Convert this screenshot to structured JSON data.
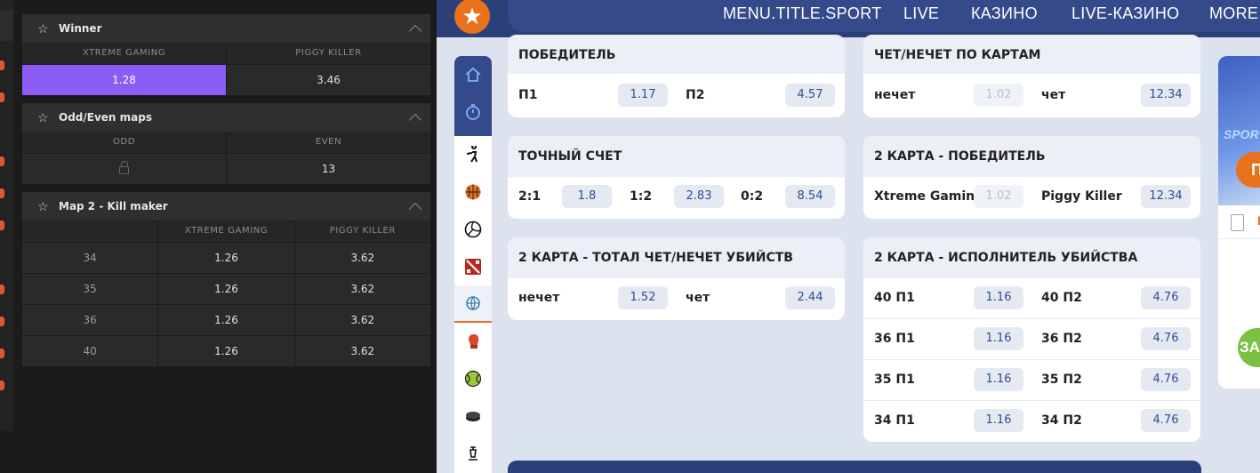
{
  "left_panel": {
    "winner": {
      "title": "Winner",
      "columns": [
        "XTREME GAMING",
        "PIGGY KILLER"
      ],
      "odds": [
        "1.28",
        "3.46"
      ]
    },
    "odd_even": {
      "title": "Odd/Even maps",
      "columns": [
        "ODD",
        "EVEN"
      ],
      "odds": [
        "",
        "13"
      ]
    },
    "kill_maker": {
      "title": "Map 2 - Kill maker",
      "columns": [
        "",
        "XTREME GAMING",
        "PIGGY KILLER"
      ],
      "rows": [
        {
          "label": "34",
          "a": "1.26",
          "b": "3.62"
        },
        {
          "label": "35",
          "a": "1.26",
          "b": "3.62"
        },
        {
          "label": "36",
          "a": "1.26",
          "b": "3.62"
        },
        {
          "label": "40",
          "a": "1.26",
          "b": "3.62"
        }
      ]
    }
  },
  "nav": {
    "items": [
      "MENU.TITLE.SPORT",
      "LIVE",
      "КАЗИНО",
      "LIVE-КАЗИНО",
      "MORE ..."
    ]
  },
  "sidebar_icons": [
    "home-icon",
    "stopwatch-icon",
    "cs-soldier-icon",
    "basketball-icon",
    "volleyball-icon",
    "dota-icon",
    "esports-globe-icon",
    "boxing-icon",
    "tennis-icon",
    "hockey-puck-icon",
    "chess-icon"
  ],
  "markets": {
    "winner": {
      "title": "ПОБЕДИТЕЛЬ",
      "items": [
        {
          "label": "П1",
          "odd": "1.17"
        },
        {
          "label": "П2",
          "odd": "4.57"
        }
      ]
    },
    "parity": {
      "title": "ЧЕТ/НЕЧЕТ ПО КАРТАМ",
      "items": [
        {
          "label": "нечет",
          "odd": "1.02"
        },
        {
          "label": "чет",
          "odd": "12.34"
        }
      ]
    },
    "exact": {
      "title": "ТОЧНЫЙ СЧЕТ",
      "items": [
        {
          "label": "2:1",
          "odd": "1.8"
        },
        {
          "label": "1:2",
          "odd": "2.83"
        },
        {
          "label": "0:2",
          "odd": "8.54"
        }
      ]
    },
    "map2_winner": {
      "title": "2 КАРТА - ПОБЕДИТЕЛЬ",
      "items": [
        {
          "label": "Xtreme Gaming",
          "odd": "1.02"
        },
        {
          "label": "Piggy Killer",
          "odd": "12.34"
        }
      ]
    },
    "map2_total": {
      "title": "2 КАРТА - ТОТАЛ ЧЕТ/НЕЧЕТ УБИЙСТВ",
      "items": [
        {
          "label": "нечет",
          "odd": "1.52"
        },
        {
          "label": "чет",
          "odd": "2.44"
        }
      ]
    },
    "map2_killer": {
      "title": "2 КАРТА - ИСПОЛНИТЕЛЬ УБИЙСТВА",
      "rows": [
        {
          "l1": "40 П1",
          "o1": "1.16",
          "l2": "40 П2",
          "o2": "4.76"
        },
        {
          "l1": "36 П1",
          "o1": "1.16",
          "l2": "36 П2",
          "o2": "4.76"
        },
        {
          "l1": "35 П1",
          "o1": "1.16",
          "l2": "35 П2",
          "o2": "4.76"
        },
        {
          "l1": "34 П1",
          "o1": "1.16",
          "l2": "34 П2",
          "o2": "4.76"
        }
      ]
    }
  },
  "promo": {
    "sport_text": "SPORT",
    "button1": "П",
    "bar_text": "К",
    "button2": "ЗА"
  },
  "colors": {
    "selected_odd": "#8b5cf6",
    "navy": "#2b3f78",
    "accent_orange": "#e8711c",
    "odd_text": "#2d4f94"
  }
}
